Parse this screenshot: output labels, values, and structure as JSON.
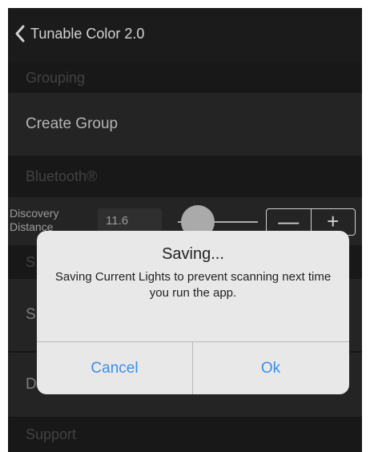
{
  "nav": {
    "title": "Tunable Color 2.0"
  },
  "sections": {
    "grouping": "Grouping",
    "create_group": "Create Group",
    "bluetooth": "Bluetooth®",
    "support": "Support"
  },
  "discovery": {
    "label_line1": "Discovery",
    "label_line2": "Distance",
    "value": "11.6",
    "minus": "—",
    "plus": "+"
  },
  "hidden_rows": {
    "row_a_initial": "S",
    "row_b_initial": "S",
    "row_c_initial": "D"
  },
  "alert": {
    "title": "Saving...",
    "message": "Saving Current Lights to prevent scanning next time you run the app.",
    "cancel": "Cancel",
    "ok": "Ok"
  },
  "colors": {
    "accent": "#3b8ee8",
    "background": "#1c1c1c",
    "row": "#2c2c2c"
  }
}
